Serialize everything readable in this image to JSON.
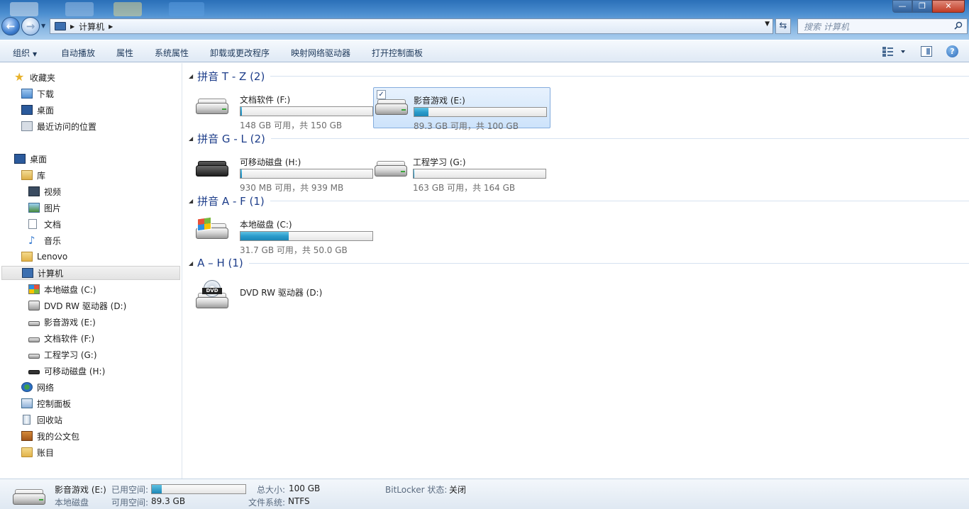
{
  "address": {
    "path": [
      "计算机"
    ],
    "search_placeholder": "搜索 计算机"
  },
  "window_controls": {
    "minimize": "—",
    "maximize": "❐",
    "close": "✕"
  },
  "toolbar": {
    "organize": "组织",
    "autoplay": "自动播放",
    "properties": "属性",
    "system_properties": "系统属性",
    "uninstall": "卸载或更改程序",
    "map_drive": "映射网络驱动器",
    "control_panel": "打开控制面板",
    "help": "?"
  },
  "nav": {
    "favorites": "收藏夹",
    "downloads": "下载",
    "desktop_fav": "桌面",
    "recent": "最近访问的位置",
    "desktop": "桌面",
    "libraries": "库",
    "videos": "视频",
    "pictures": "图片",
    "documents": "文档",
    "music": "音乐",
    "user": "Lenovo",
    "computer": "计算机",
    "drive_c": "本地磁盘 (C:)",
    "drive_d": "DVD RW 驱动器 (D:)",
    "drive_e": "影音游戏 (E:)",
    "drive_f": "文档软件 (F:)",
    "drive_g": "工程学习 (G:)",
    "drive_h": "可移动磁盘 (H:)",
    "network": "网络",
    "control_panel": "控制面板",
    "recycle_bin": "回收站",
    "briefcase": "我的公文包",
    "ledger": "账目"
  },
  "groups": [
    {
      "title": "拼音 T - Z (2)"
    },
    {
      "title": "拼音 G - L (2)"
    },
    {
      "title": "拼音 A - F (1)"
    },
    {
      "title": "A – H (1)"
    }
  ],
  "drives": {
    "f": {
      "name": "文档软件 (F:)",
      "space": "148 GB 可用，共 150 GB",
      "used_fraction": 0.013
    },
    "e": {
      "name": "影音游戏 (E:)",
      "space": "89.3 GB 可用，共 100 GB",
      "used_fraction": 0.107,
      "checked": "✓"
    },
    "h": {
      "name": "可移动磁盘 (H:)",
      "space": "930 MB 可用，共 939 MB",
      "used_fraction": 0.01
    },
    "g": {
      "name": "工程学习 (G:)",
      "space": "163 GB 可用，共 164 GB",
      "used_fraction": 0.006
    },
    "c": {
      "name": "本地磁盘 (C:)",
      "space": "31.7 GB 可用，共 50.0 GB",
      "used_fraction": 0.366
    },
    "d": {
      "name": "DVD RW 驱动器 (D:)",
      "disc_label": "DVD"
    }
  },
  "details": {
    "name": "影音游戏 (E:)",
    "type": "本地磁盘",
    "used_label": "已用空间:",
    "free_label": "可用空间:",
    "free_value": "89.3 GB",
    "total_label": "总大小:",
    "total_value": "100 GB",
    "fs_label": "文件系统:",
    "fs_value": "NTFS",
    "bitlocker_label": "BitLocker 状态:",
    "bitlocker_value": "关闭",
    "used_fraction": 0.107
  },
  "colors": {
    "bar_fill": "#1c87b6",
    "group_title": "#1e3e8a",
    "selection": "#cde3fb"
  }
}
